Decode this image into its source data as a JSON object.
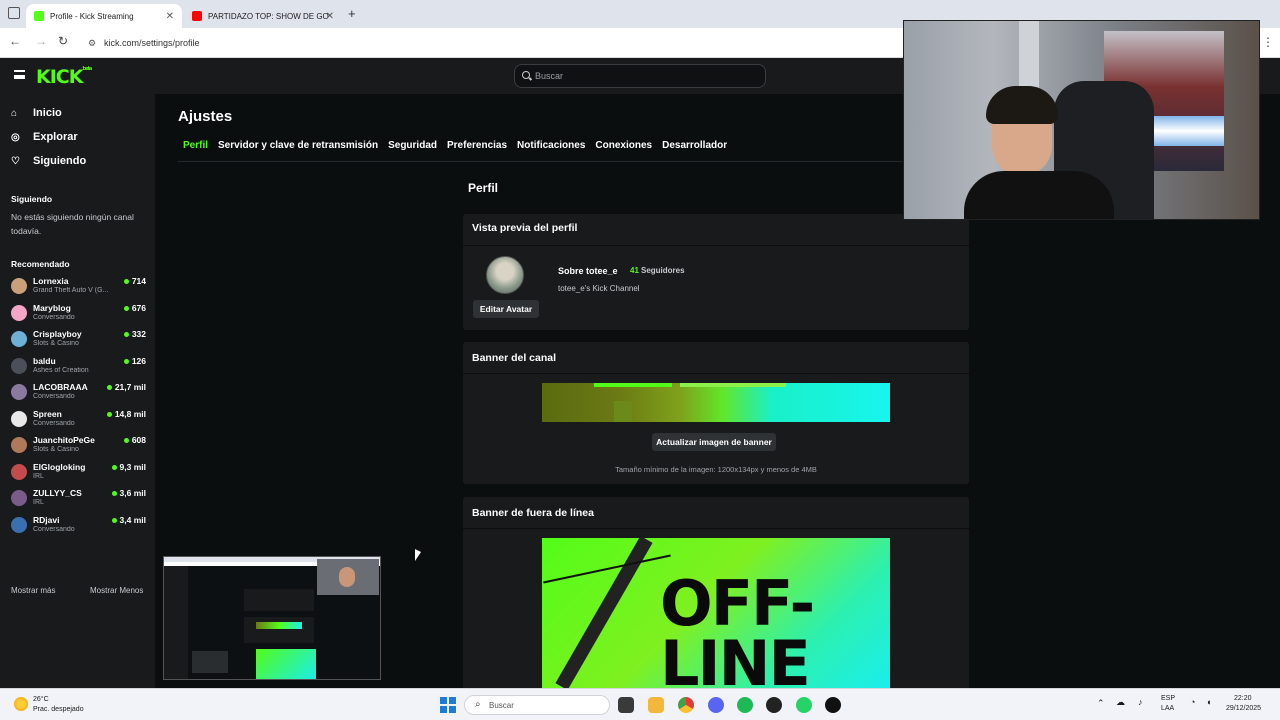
{
  "browser": {
    "tabs": [
      {
        "title": "Profile - Kick Streaming",
        "active": true
      },
      {
        "title": "PARTIDAZO TOP: SHOW DE GO",
        "active": false
      }
    ],
    "url": "kick.com/settings/profile"
  },
  "kick": {
    "logo": "KICK",
    "logo_badge": "beta",
    "search_placeholder": "Buscar",
    "nav": [
      {
        "label": "Inicio",
        "icon": "home-icon"
      },
      {
        "label": "Explorar",
        "icon": "compass-icon"
      },
      {
        "label": "Siguiendo",
        "icon": "heart-icon"
      }
    ],
    "following": {
      "heading": "Siguiendo",
      "empty_text": "No estás siguiendo ningún canal todavía."
    },
    "recommended": {
      "heading": "Recomendado",
      "channels": [
        {
          "name": "Lornexia",
          "category": "Grand Theft Auto V (G...",
          "viewers": "714",
          "color": "#c9a07a"
        },
        {
          "name": "Maryblog",
          "category": "Conversando",
          "viewers": "676",
          "color": "#f3a6c8"
        },
        {
          "name": "Crisplayboy",
          "category": "Slots & Casino",
          "viewers": "332",
          "color": "#6fb1d6"
        },
        {
          "name": "baldu",
          "category": "Ashes of Creation",
          "viewers": "126",
          "color": "#4a4f58"
        },
        {
          "name": "LACOBRAAA",
          "category": "Conversando",
          "viewers": "21,7 mil",
          "color": "#8a7aa0"
        },
        {
          "name": "Spreen",
          "category": "Conversando",
          "viewers": "14,8 mil",
          "color": "#e8e8e8"
        },
        {
          "name": "JuanchitoPeGe",
          "category": "Slots & Casino",
          "viewers": "608",
          "color": "#b07a5a"
        },
        {
          "name": "ElGlogloking",
          "category": "IRL",
          "viewers": "9,3 mil",
          "color": "#c24b4b"
        },
        {
          "name": "ZULLYY_CS",
          "category": "IRL",
          "viewers": "3,6 mil",
          "color": "#7a5c8a"
        },
        {
          "name": "RDjavi",
          "category": "Conversando",
          "viewers": "3,4 mil",
          "color": "#3a6fb0"
        }
      ],
      "show_more": "Mostrar más",
      "show_less": "Mostrar Menos"
    },
    "settings": {
      "title": "Ajustes",
      "tabs": [
        "Perfil",
        "Servidor y clave de retransmisión",
        "Seguridad",
        "Preferencias",
        "Notificaciones",
        "Conexiones",
        "Desarrollador"
      ],
      "active_tab": "Perfil",
      "section_title": "Perfil",
      "profile_preview": {
        "heading": "Vista previa del perfil",
        "about": "Sobre totee_e",
        "followers_count": "41",
        "followers_label": "Seguidores",
        "bio": "totee_e's Kick Channel",
        "edit_avatar": "Editar Avatar"
      },
      "banner": {
        "heading": "Banner del canal",
        "update_button": "Actualizar imagen de banner",
        "hint": "Tamaño mínimo de la imagen: 1200x134px y menos de 4MB"
      },
      "offline_banner": {
        "heading": "Banner de fuera de línea",
        "art_text": "OFF-LINE"
      }
    }
  },
  "taskbar": {
    "weather_temp": "26°C",
    "weather_desc": "Prac. despejado",
    "search": "Buscar",
    "lang_top": "ESP",
    "lang_bottom": "LAA",
    "time": "22:20",
    "date": "29/12/2025"
  },
  "colors": {
    "kick_green": "#53fc18",
    "page_bg": "#0b0e0f",
    "panel_bg": "#181a1c"
  }
}
